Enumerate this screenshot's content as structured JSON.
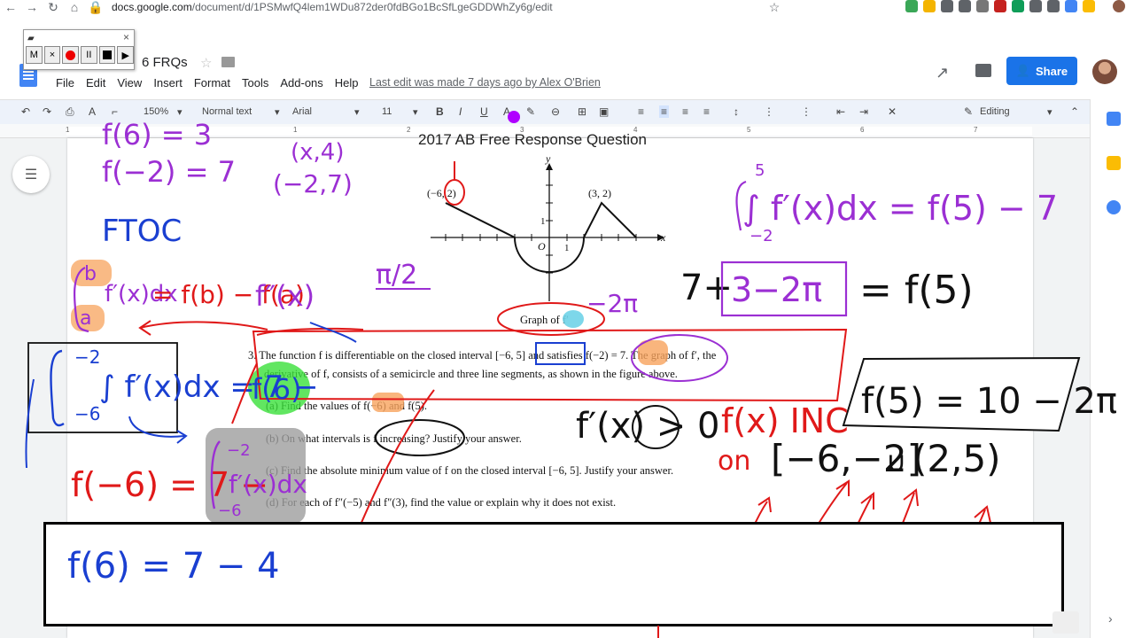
{
  "browser": {
    "url_host": "docs.google.com",
    "url_path": "/document/d/1PSMwfQ4lem1WDu872der0fdBGo1BcSfLgeGDDWhZy6g/edit"
  },
  "docs": {
    "title_fragment": "6 FRQs",
    "menu": [
      "File",
      "Edit",
      "View",
      "Insert",
      "Format",
      "Tools",
      "Add-ons",
      "Help"
    ],
    "last_edit": "Last edit was made 7 days ago by Alex O'Brien",
    "share_label": "Share"
  },
  "recorder": {
    "m_label": "M",
    "x_label": "×",
    "pause_label": "II",
    "play_label": "▶"
  },
  "toolbar": {
    "zoom": "150%",
    "style": "Normal text",
    "font": "Arial",
    "size": "11",
    "mode": "Editing"
  },
  "ruler_numbers": [
    "1",
    "1",
    "2",
    "3",
    "4",
    "5",
    "6",
    "7"
  ],
  "document": {
    "heading": "2017 AB Free Response Question",
    "graph_caption": "Graph of f′",
    "lines": [
      "3.   The function f is differentiable on the closed interval [−6, 5] and satisfies f(−2) = 7.  The graph of f′, the",
      "derivative of f, consists of a semicircle and three line segments, as shown in the figure above.",
      "(a)  Find the values of f(−6) and f(5).",
      "(b)  On what intervals is f increasing? Justify your answer.",
      "(c)  Find the absolute minimum value of f on the closed interval [−6, 5].  Justify your answer.",
      "(d)  For each of f″(−5) and f″(3), find the value or explain why it does not exist."
    ],
    "graph_labels": {
      "point_left": "(−6, 2)",
      "point_right": "(3, 2)",
      "x": "x",
      "y": "y",
      "origin": "O",
      "one_x": "1",
      "one_y": "1"
    }
  },
  "annotations": {
    "purple_f6": "f(6) = 3",
    "purple_f2": "f(−2) = 7",
    "purple_x4": "(x,4)",
    "purple_m27": "(−2,7)",
    "blue_ftoc": "FTOC",
    "purple_pi2": "π/2",
    "purple_2pi": "−2π",
    "black_integral": "∫ f′(x)dx = f(5) − 7",
    "black_int_lower": "−2",
    "black_int_upper": "5",
    "black_7plus": "7+",
    "purple_bracket": "3−2π",
    "black_eq_f5": "= f(5)",
    "black_result": "f(5) = 10 − 2π",
    "red_ftoc_rule": "= f(b) − f(a)",
    "purple_fprime_b": "b",
    "purple_fprime_a": "a",
    "purple_fprime": "f′(x)dx",
    "purple_fpp": "f″(x)",
    "blue_integral": "∫ f′(x)dx = 7 −",
    "blue_int_upper": "−2",
    "blue_int_lower": "−6",
    "blue_f6": "f(6)",
    "black_fprime_gt0": "f′(x) > 0",
    "red_fx_inc": "f(x) INC",
    "red_on": "on",
    "black_interval1": "[−6,−2]",
    "black_union": "∪",
    "black_interval2": "(2,5)",
    "red_f6eq": "f(−6) = 7 −",
    "purple_int_upper": "−2",
    "purple_int_lower": "−6",
    "purple_fprime2": "f′(x)dx",
    "blue_final": "f(6) = 7 − 4"
  },
  "colors": {
    "share": "#1a73e8",
    "ink_red": "#e01919",
    "ink_purple": "#9b2fd3",
    "ink_blue": "#1a3fd1",
    "ink_black": "#111111",
    "highlight_green": "#39e03a",
    "highlight_orange": "#f7a35c",
    "highlight_gray": "#9e9e9e"
  }
}
